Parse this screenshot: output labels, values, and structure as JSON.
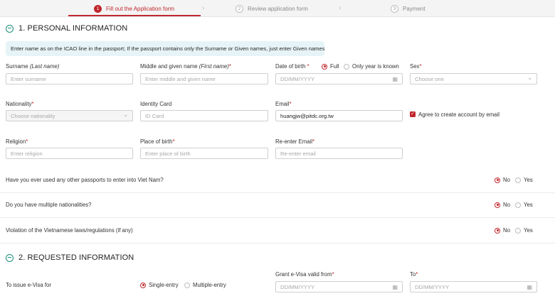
{
  "stepper": {
    "steps": [
      {
        "num": "1",
        "label": "Fill out the Application form"
      },
      {
        "num": "2",
        "label": "Review application form"
      },
      {
        "num": "3",
        "label": "Payment"
      }
    ],
    "chevron": "›"
  },
  "section1": {
    "title": "1. PERSONAL INFORMATION"
  },
  "info": "Enter name as on the ICAO line in the passport; If the passport contains only the Surname or Given names, just enter Given names",
  "fields": {
    "surname": {
      "label": "Surname",
      "label_note": "(Last name)",
      "placeholder": "Enter surname"
    },
    "given_name": {
      "label": "Middle and given name",
      "label_note": "(First name)",
      "required": "*",
      "placeholder": "Enter middle and given name"
    },
    "dob": {
      "label": "Date of birth",
      "required": "*",
      "placeholder": "DD/MM/YYYY",
      "opt_full": "Full",
      "opt_year": "Only year is known"
    },
    "sex": {
      "label": "Sex",
      "required": "*",
      "placeholder": "Choose one"
    },
    "nationality": {
      "label": "Nationality",
      "required": "*",
      "placeholder": "Choose nationality"
    },
    "id_card": {
      "label": "Identity Card",
      "placeholder": "ID Card"
    },
    "email": {
      "label": "Email",
      "required": "*",
      "value": "huangjw@pitdc.org.tw"
    },
    "agree": {
      "label": "Agree to create account by email"
    },
    "religion": {
      "label": "Religion",
      "required": "*",
      "placeholder": "Enter religion"
    },
    "place_of_birth": {
      "label": "Place of birth",
      "required": "*",
      "placeholder": "Enter place of birth"
    },
    "reenter_email": {
      "label": "Re-enter Email",
      "required": "*",
      "placeholder": "Re-enter email"
    }
  },
  "questions": [
    {
      "text": "Have you ever used any other passports to enter into Viet Nam?",
      "no": "No",
      "yes": "Yes"
    },
    {
      "text": "Do you have multiple nationalities?",
      "no": "No",
      "yes": "Yes"
    },
    {
      "text": "Violation of the Vietnamese laws/regulations (if any)",
      "no": "No",
      "yes": "Yes"
    }
  ],
  "section2": {
    "title": "2. REQUESTED INFORMATION"
  },
  "requested": {
    "issue_label": "To issue e-Visa for",
    "single": "Single-entry",
    "multiple": "Multiple-entry",
    "valid_from": {
      "label": "Grant e-Visa valid from",
      "required": "*",
      "placeholder": "DD/MM/YYYY"
    },
    "to": {
      "label": "To",
      "required": "*",
      "placeholder": "DD/MM/YYYY"
    }
  },
  "icons": {
    "calendar": "▦",
    "chevron_down": "⌄",
    "check": "✓"
  },
  "colors": {
    "accent": "#c0272d",
    "section_icon": "#1a8f7a",
    "info_bg": "#e6f4f7"
  }
}
